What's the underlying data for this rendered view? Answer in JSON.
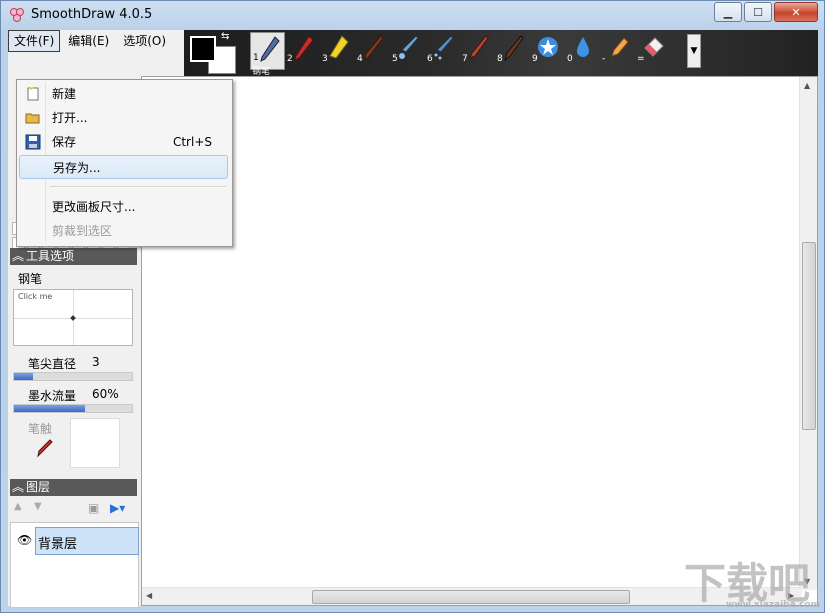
{
  "window": {
    "title": "SmoothDraw 4.0.5"
  },
  "menubar": {
    "file": "文件(F)",
    "edit": "编辑(E)",
    "options": "选项(O)"
  },
  "file_menu": {
    "items": [
      {
        "label": "新建",
        "shortcut": "",
        "icon": "new-file-icon"
      },
      {
        "label": "打开...",
        "shortcut": "",
        "icon": "open-folder-icon"
      },
      {
        "label": "保存",
        "shortcut": "Ctrl+S",
        "icon": "save-disk-icon"
      },
      {
        "label": "另存为...",
        "shortcut": ""
      },
      {
        "label": "更改画板尺寸...",
        "shortcut": ""
      },
      {
        "label": "剪裁到选区",
        "shortcut": "",
        "disabled": true
      }
    ]
  },
  "toolbar": {
    "selected_tool_label": "钢笔",
    "tools": [
      {
        "num": "1",
        "name": "pen"
      },
      {
        "num": "2",
        "name": "pencil"
      },
      {
        "num": "3",
        "name": "highlighter"
      },
      {
        "num": "4",
        "name": "brush"
      },
      {
        "num": "5",
        "name": "airbrush"
      },
      {
        "num": "6",
        "name": "spray"
      },
      {
        "num": "7",
        "name": "flat-brush"
      },
      {
        "num": "8",
        "name": "ink-brush"
      },
      {
        "num": "9",
        "name": "star"
      },
      {
        "num": "0",
        "name": "water-drop"
      },
      {
        "num": "-",
        "name": "smudge-finger"
      },
      {
        "num": "=",
        "name": "eraser"
      }
    ],
    "foreground_color": "#000000",
    "background_color": "#ffffff"
  },
  "tool_options": {
    "header": "工具选项",
    "tool_name": "钢笔",
    "preview_hint": "Click me",
    "tip_diameter_label": "笔尖直径",
    "tip_diameter_value": "3",
    "tip_diameter_fraction": 0.16,
    "ink_flow_label": "墨水流量",
    "ink_flow_value": "60%",
    "ink_flow_fraction": 0.6,
    "brush_tip_label": "笔触"
  },
  "layers": {
    "header": "图层",
    "items": [
      {
        "name": "背景层",
        "visible": true
      }
    ]
  },
  "watermark": {
    "text": "下载吧",
    "url": "www.xiazaiba.com"
  }
}
